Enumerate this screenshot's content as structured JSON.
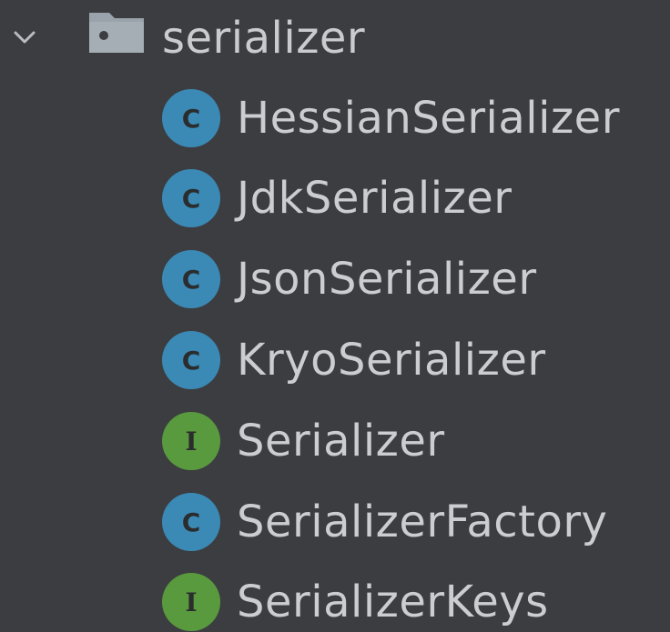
{
  "folder": {
    "label": "serializer",
    "expand_icon": "chevron-down-icon",
    "folder_icon": "folder-icon"
  },
  "items": [
    {
      "label": "HessianSerializer",
      "kind": "class",
      "badge": "C"
    },
    {
      "label": "JdkSerializer",
      "kind": "class",
      "badge": "C"
    },
    {
      "label": "JsonSerializer",
      "kind": "class",
      "badge": "C"
    },
    {
      "label": "KryoSerializer",
      "kind": "class",
      "badge": "C"
    },
    {
      "label": "Serializer",
      "kind": "interface",
      "badge": "I"
    },
    {
      "label": "SerializerFactory",
      "kind": "class",
      "badge": "C"
    },
    {
      "label": "SerializerKeys",
      "kind": "interface",
      "badge": "I"
    }
  ],
  "colors": {
    "background": "#3b3d40",
    "text": "#cbcdd0",
    "class_badge": "#3b8ab5",
    "interface_badge": "#5a9a3e",
    "folder": "#9aa3ab"
  }
}
